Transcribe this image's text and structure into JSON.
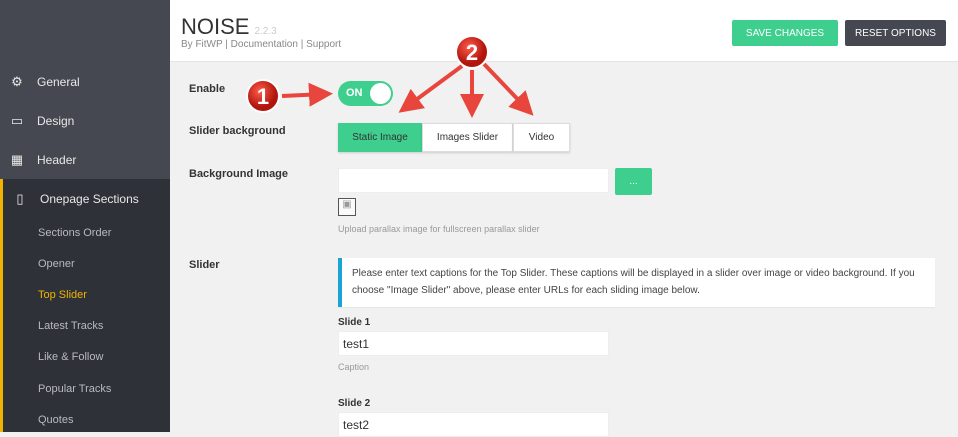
{
  "sidebar": {
    "items": [
      {
        "label": "General",
        "icon": "gear-icon",
        "glyph": "⚙"
      },
      {
        "label": "Design",
        "icon": "monitor-icon",
        "glyph": "▭"
      },
      {
        "label": "Header",
        "icon": "grid-icon",
        "glyph": "▦"
      },
      {
        "label": "Onepage Sections",
        "icon": "page-icon",
        "glyph": "▯"
      }
    ],
    "subitems": [
      "Sections Order",
      "Opener",
      "Top Slider",
      "Latest Tracks",
      "Like & Follow",
      "Popular Tracks",
      "Quotes"
    ]
  },
  "header": {
    "title": "NOISE",
    "version": "2.2.3",
    "by": "By FitWP",
    "doc": "Documentation",
    "support": "Support",
    "sep": "|",
    "save": "SAVE CHANGES",
    "reset": "RESET OPTIONS"
  },
  "form": {
    "enable_label": "Enable",
    "toggle": "ON",
    "slider_bg_label": "Slider background",
    "options": [
      "Static Image",
      "Images Slider",
      "Video"
    ],
    "bg_image_label": "Background Image",
    "bg_image_value": "",
    "browse": "...",
    "bg_help": "Upload parallax image for fullscreen parallax slider",
    "slider_label": "Slider",
    "info": "Please enter text captions for the Top Slider. These captions will be displayed in a slider over image or video background. If you choose \"Image Slider\" above, please enter URLs for each sliding image below.",
    "slide1_label": "Slide 1",
    "slide1_value": "test1",
    "caption": "Caption",
    "slide2_label": "Slide 2",
    "slide2_value": "test2"
  },
  "annotations": {
    "one": "1",
    "two": "2",
    "color": "#e8453c"
  },
  "colors": {
    "accent": "#3ecf8e",
    "sidebar": "#454850",
    "active": "#f0b400"
  }
}
